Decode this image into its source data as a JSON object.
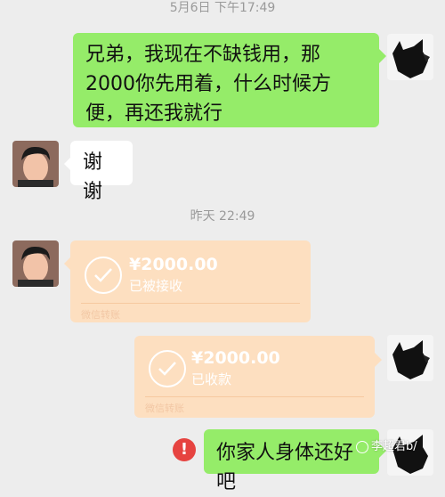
{
  "timestamps": [
    "5月6日 下午17:49",
    "昨天 22:49"
  ],
  "messages": {
    "msg1": "兄弟，我现在不缺钱用，那2000你先用着，什么时候方便，再还我就行",
    "msg2": "谢谢",
    "msg5": "你家人身体还好吧"
  },
  "transfers": [
    {
      "amount": "¥2000.00",
      "status": "已被接收",
      "footer": "微信转账"
    },
    {
      "amount": "¥2000.00",
      "status": "已收款",
      "footer": "微信转账"
    }
  ],
  "watermark": "李超君b/",
  "error_badge": "!",
  "colors": {
    "background": "#ededed",
    "sent_bubble": "#95ec69",
    "received_bubble": "#ffffff",
    "transfer_bubble": "#fddfc0",
    "error": "#e64340"
  },
  "icons": [
    "cat-avatar-icon",
    "man-avatar-icon",
    "check-circle-icon",
    "error-icon"
  ]
}
